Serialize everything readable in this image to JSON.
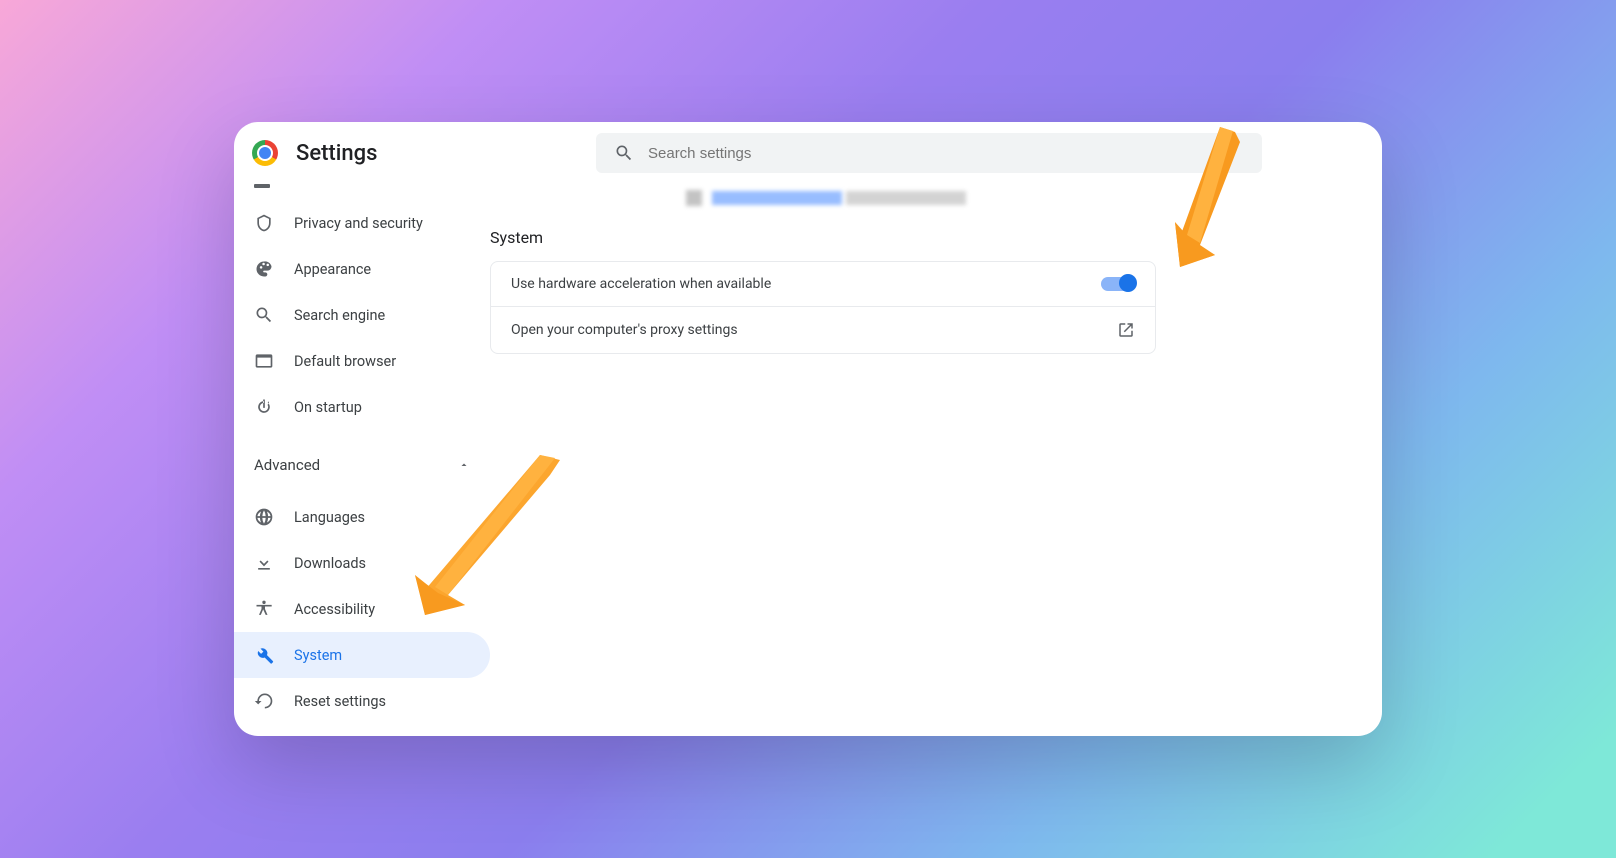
{
  "header": {
    "title": "Settings"
  },
  "search": {
    "placeholder": "Search settings"
  },
  "sidebar": {
    "items": [
      {
        "label": "Privacy and security",
        "icon": "shield"
      },
      {
        "label": "Appearance",
        "icon": "palette"
      },
      {
        "label": "Search engine",
        "icon": "search"
      },
      {
        "label": "Default browser",
        "icon": "browser"
      },
      {
        "label": "On startup",
        "icon": "power"
      }
    ],
    "advanced_label": "Advanced",
    "advanced_items": [
      {
        "label": "Languages",
        "icon": "globe"
      },
      {
        "label": "Downloads",
        "icon": "download"
      },
      {
        "label": "Accessibility",
        "icon": "accessibility"
      },
      {
        "label": "System",
        "icon": "wrench",
        "active": true
      },
      {
        "label": "Reset settings",
        "icon": "restore"
      }
    ]
  },
  "main": {
    "section_title": "System",
    "rows": [
      {
        "label": "Use hardware acceleration when available",
        "toggle_on": true
      },
      {
        "label": "Open your computer's proxy settings"
      }
    ]
  },
  "annotations": {
    "arrows": [
      "pointing-to-system-nav",
      "pointing-to-toggle"
    ]
  }
}
